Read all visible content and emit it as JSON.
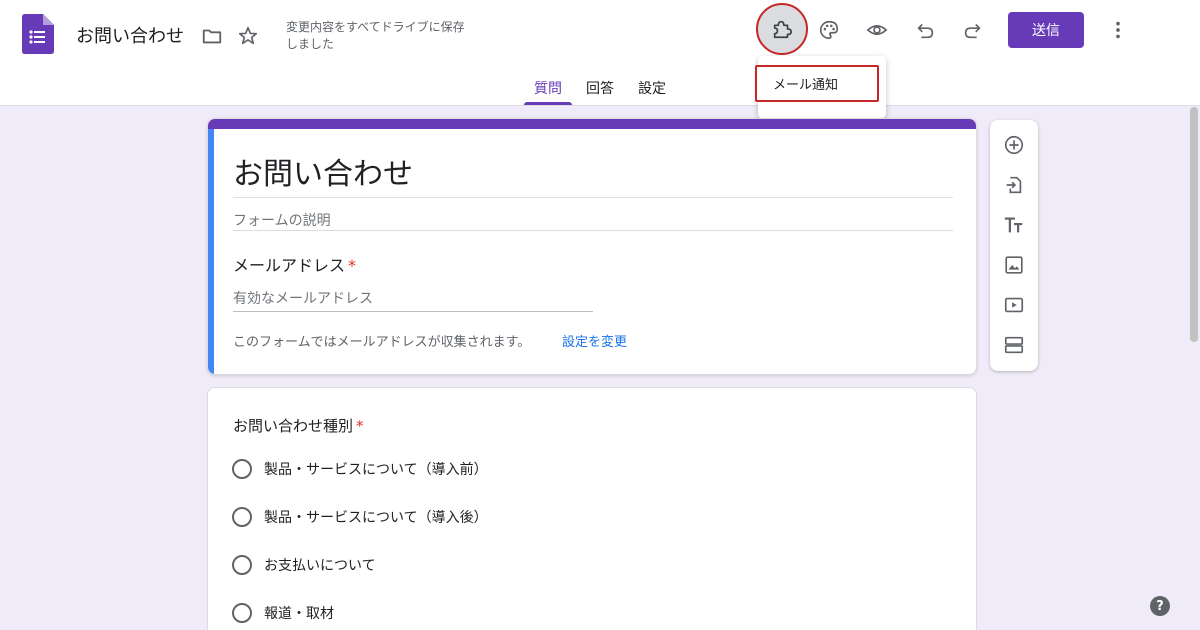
{
  "header": {
    "title": "お問い合わせ",
    "save_status": "変更内容をすべてドライブに保存しました",
    "send_label": "送信",
    "icons": {
      "logo": "google-forms-icon",
      "folder": "folder-icon",
      "star": "star-icon",
      "addons": "puzzle-piece-icon",
      "palette": "palette-icon",
      "preview": "eye-icon",
      "undo": "undo-icon",
      "redo": "redo-icon",
      "more": "more-vert-icon"
    }
  },
  "tabs": [
    {
      "label": "質問",
      "active": true
    },
    {
      "label": "回答",
      "active": false
    },
    {
      "label": "設定",
      "active": false
    }
  ],
  "addon_menu": {
    "items": [
      "メール通知"
    ]
  },
  "form": {
    "title": "お問い合わせ",
    "description_placeholder": "フォームの説明",
    "email_question": {
      "label": "メールアドレス",
      "required_mark": "*",
      "placeholder": "有効なメールアドレス",
      "collection_note": "このフォームではメールアドレスが収集されます。",
      "change_link": "設定を変更"
    },
    "question": {
      "title": "お問い合わせ種別",
      "required_mark": "*",
      "options": [
        "製品・サービスについて（導入前）",
        "製品・サービスについて（導入後）",
        "お支払いについて",
        "報道・取材"
      ]
    }
  },
  "side_toolbar": {
    "tools": [
      "add-question-icon",
      "import-questions-icon",
      "add-title-icon",
      "add-image-icon",
      "add-video-icon",
      "add-section-icon"
    ]
  },
  "colors": {
    "accent": "#673ab7",
    "title_card_left_bar": "#4285f4",
    "background": "#f0ebf8",
    "highlight_red": "#c62828",
    "required": "#d93025",
    "link": "#1a73e8"
  },
  "help_icon": "help-icon",
  "help_glyph": "?"
}
